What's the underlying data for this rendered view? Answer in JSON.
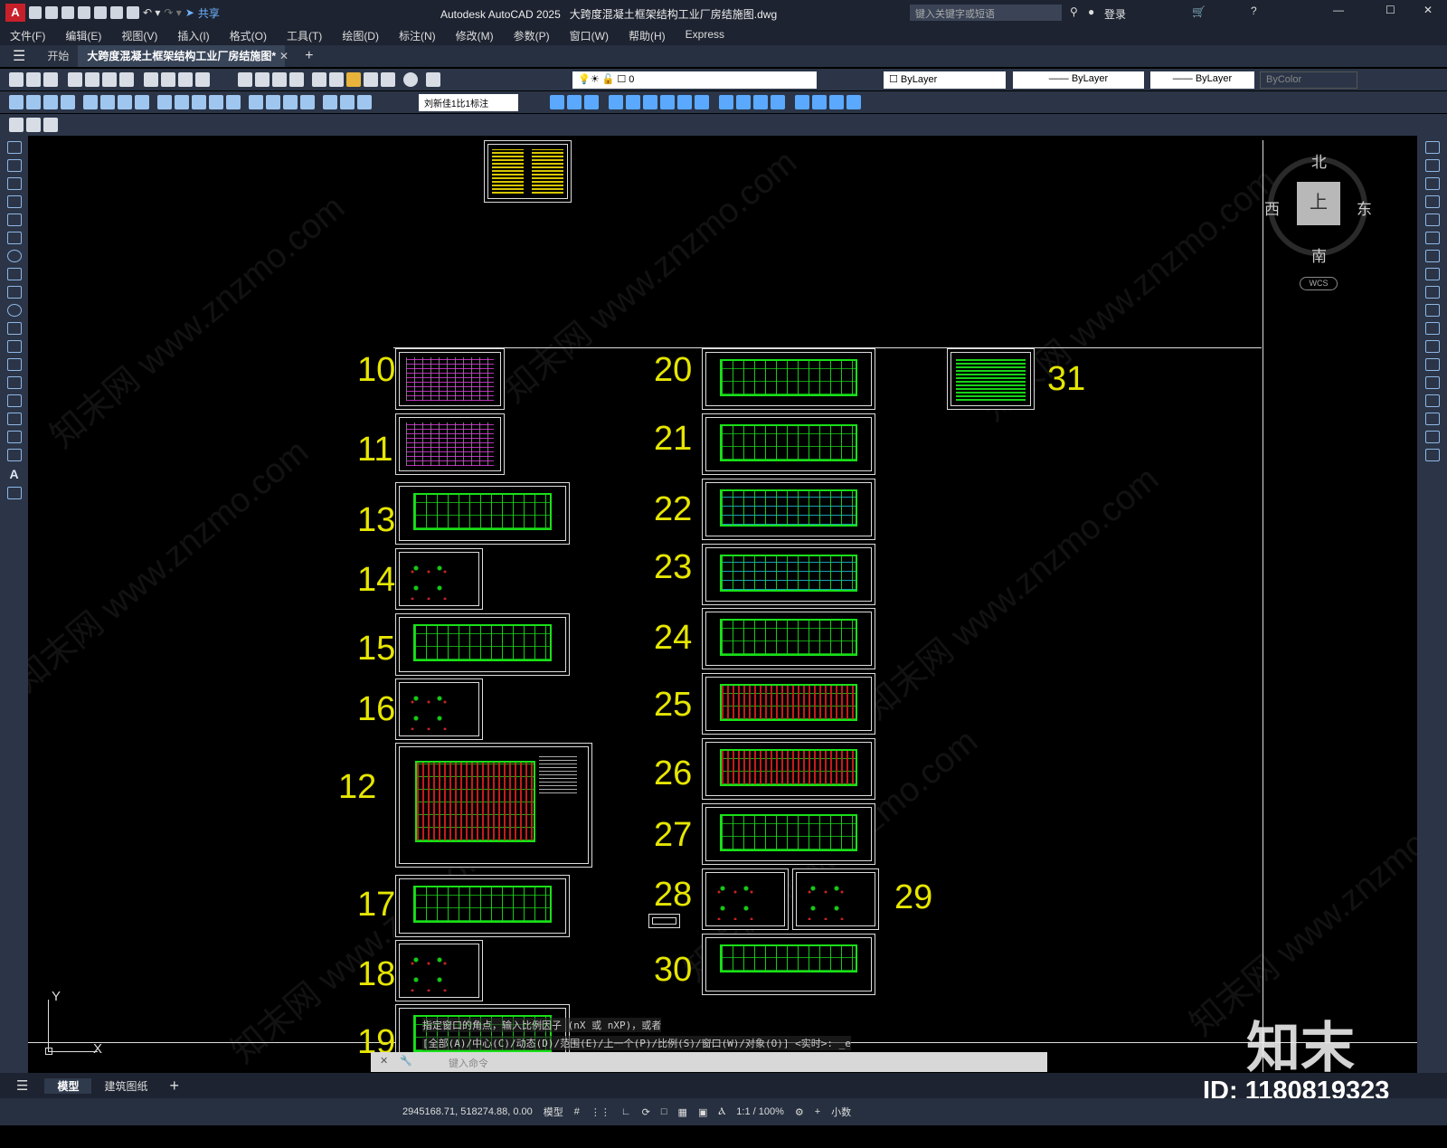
{
  "titlebar": {
    "app": "Autodesk AutoCAD 2025",
    "file": "大跨度混凝土框架结构工业厂房结施图.dwg",
    "share": "共享",
    "search_placeholder": "键入关键字或短语",
    "login": "登录"
  },
  "menus": [
    "文件(F)",
    "编辑(E)",
    "视图(V)",
    "插入(I)",
    "格式(O)",
    "工具(T)",
    "绘图(D)",
    "标注(N)",
    "修改(M)",
    "参数(P)",
    "窗口(W)",
    "帮助(H)",
    "Express"
  ],
  "tabs": {
    "start": "开始",
    "doc": "大跨度混凝土框架结构工业厂房结施图*"
  },
  "toolbar": {
    "layer": "0",
    "color": "ByLayer",
    "linetype": "ByLayer",
    "lineweight": "ByLayer",
    "plotstyle": "ByColor",
    "dimstyle": "刘新佳1比1标注"
  },
  "viewcube": {
    "north": "北",
    "south": "南",
    "east": "东",
    "west": "西",
    "top": "上",
    "wcs": "WCS"
  },
  "sheet_numbers": {
    "n10": "10",
    "n11": "11",
    "n12": "12",
    "n13": "13",
    "n14": "14",
    "n15": "15",
    "n16": "16",
    "n17": "17",
    "n18": "18",
    "n19": "19",
    "n20": "20",
    "n21": "21",
    "n22": "22",
    "n23": "23",
    "n24": "24",
    "n25": "25",
    "n26": "26",
    "n27": "27",
    "n28": "28",
    "n29": "29",
    "n30": "30",
    "n31": "31"
  },
  "ucs": {
    "x": "X",
    "y": "Y"
  },
  "command": {
    "line1": "指定窗口的角点，输入比例因子 (nX 或 nXP)，或者",
    "line2": "[全部(A)/中心(C)/动态(D)/范围(E)/上一个(P)/比例(S)/窗口(W)/对象(O)] <实时>: _e",
    "placeholder": "键入命令"
  },
  "layouts": {
    "model": "模型",
    "sheet": "建筑图纸"
  },
  "status": {
    "coords": "2945168.71, 518274.88, 0.00",
    "mode": "模型",
    "scale": "1:1 / 100%",
    "units": "小数"
  },
  "watermark": {
    "brand": "知末",
    "id": "ID: 1180819323",
    "site": "知末网 www.znzmo.com"
  }
}
